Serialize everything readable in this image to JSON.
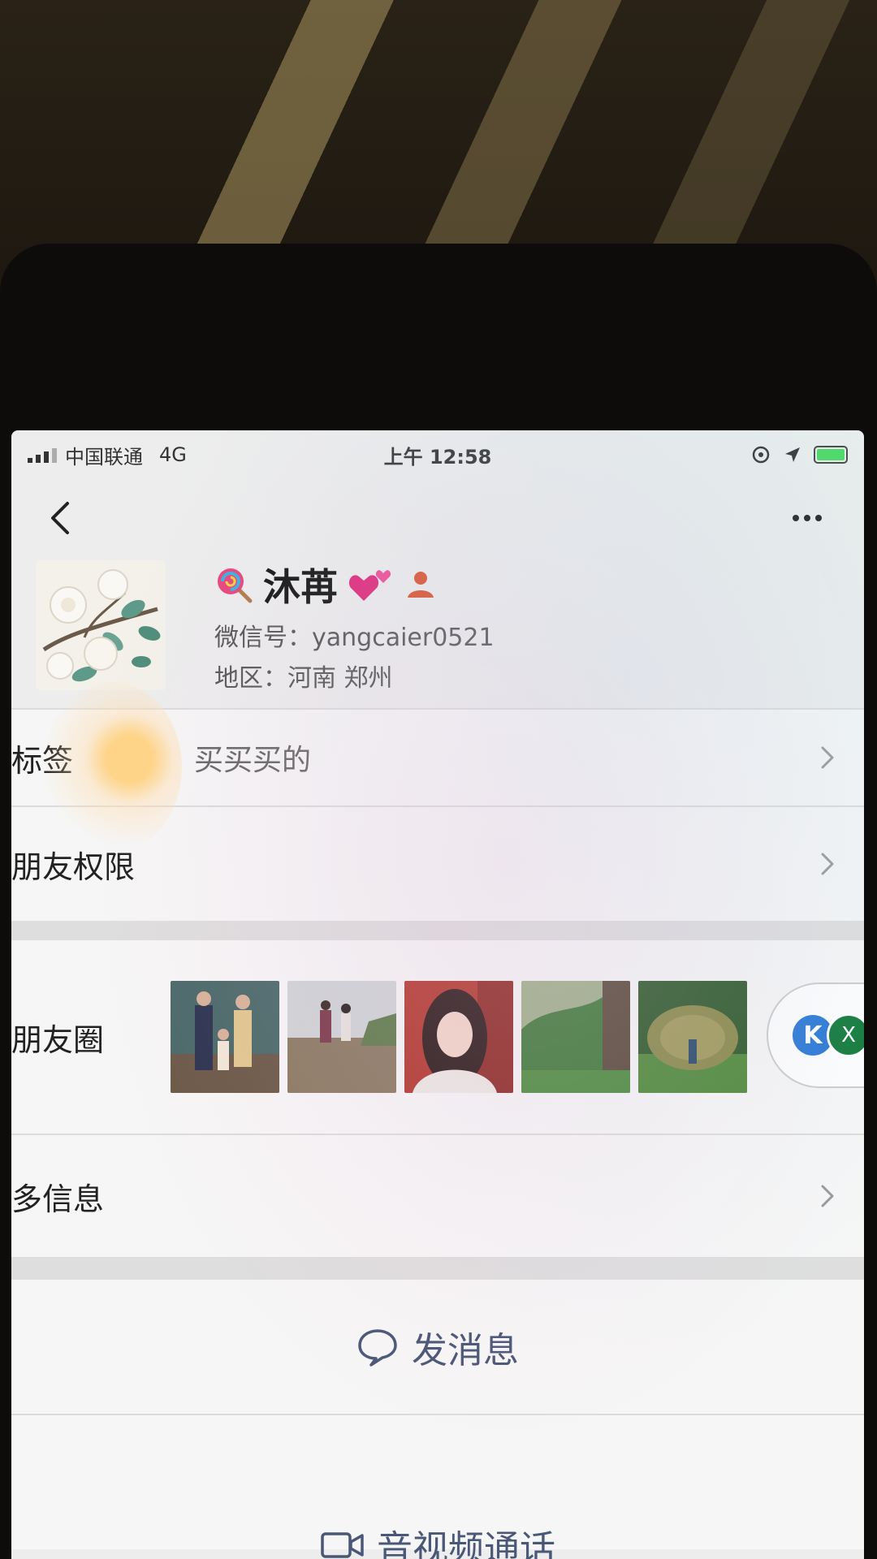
{
  "status_bar": {
    "carrier": "中国联通",
    "network": "4G",
    "time": "上午 12:58"
  },
  "profile": {
    "name": "沐苒",
    "wechat_id": "微信号：yangcaier0521",
    "region": "地区：河南 郑州",
    "name_icons": [
      "lollipop-icon",
      "hearts-icon",
      "user-silhouette-icon"
    ]
  },
  "rows": {
    "tags_label": "标签",
    "tags_value": "买买买的",
    "moments_permission_label": "朋友权限",
    "moments_label": "朋友圈",
    "more_info_label": "多信息"
  },
  "floating": {
    "k_label": "K",
    "x_label": "X"
  },
  "actions": {
    "send_message": "发消息",
    "video_call_partial": "音视频通话"
  },
  "colors": {
    "action_text": "#4a5878",
    "battery": "#4cd964",
    "avatar_bg": "#f3f1ea"
  }
}
